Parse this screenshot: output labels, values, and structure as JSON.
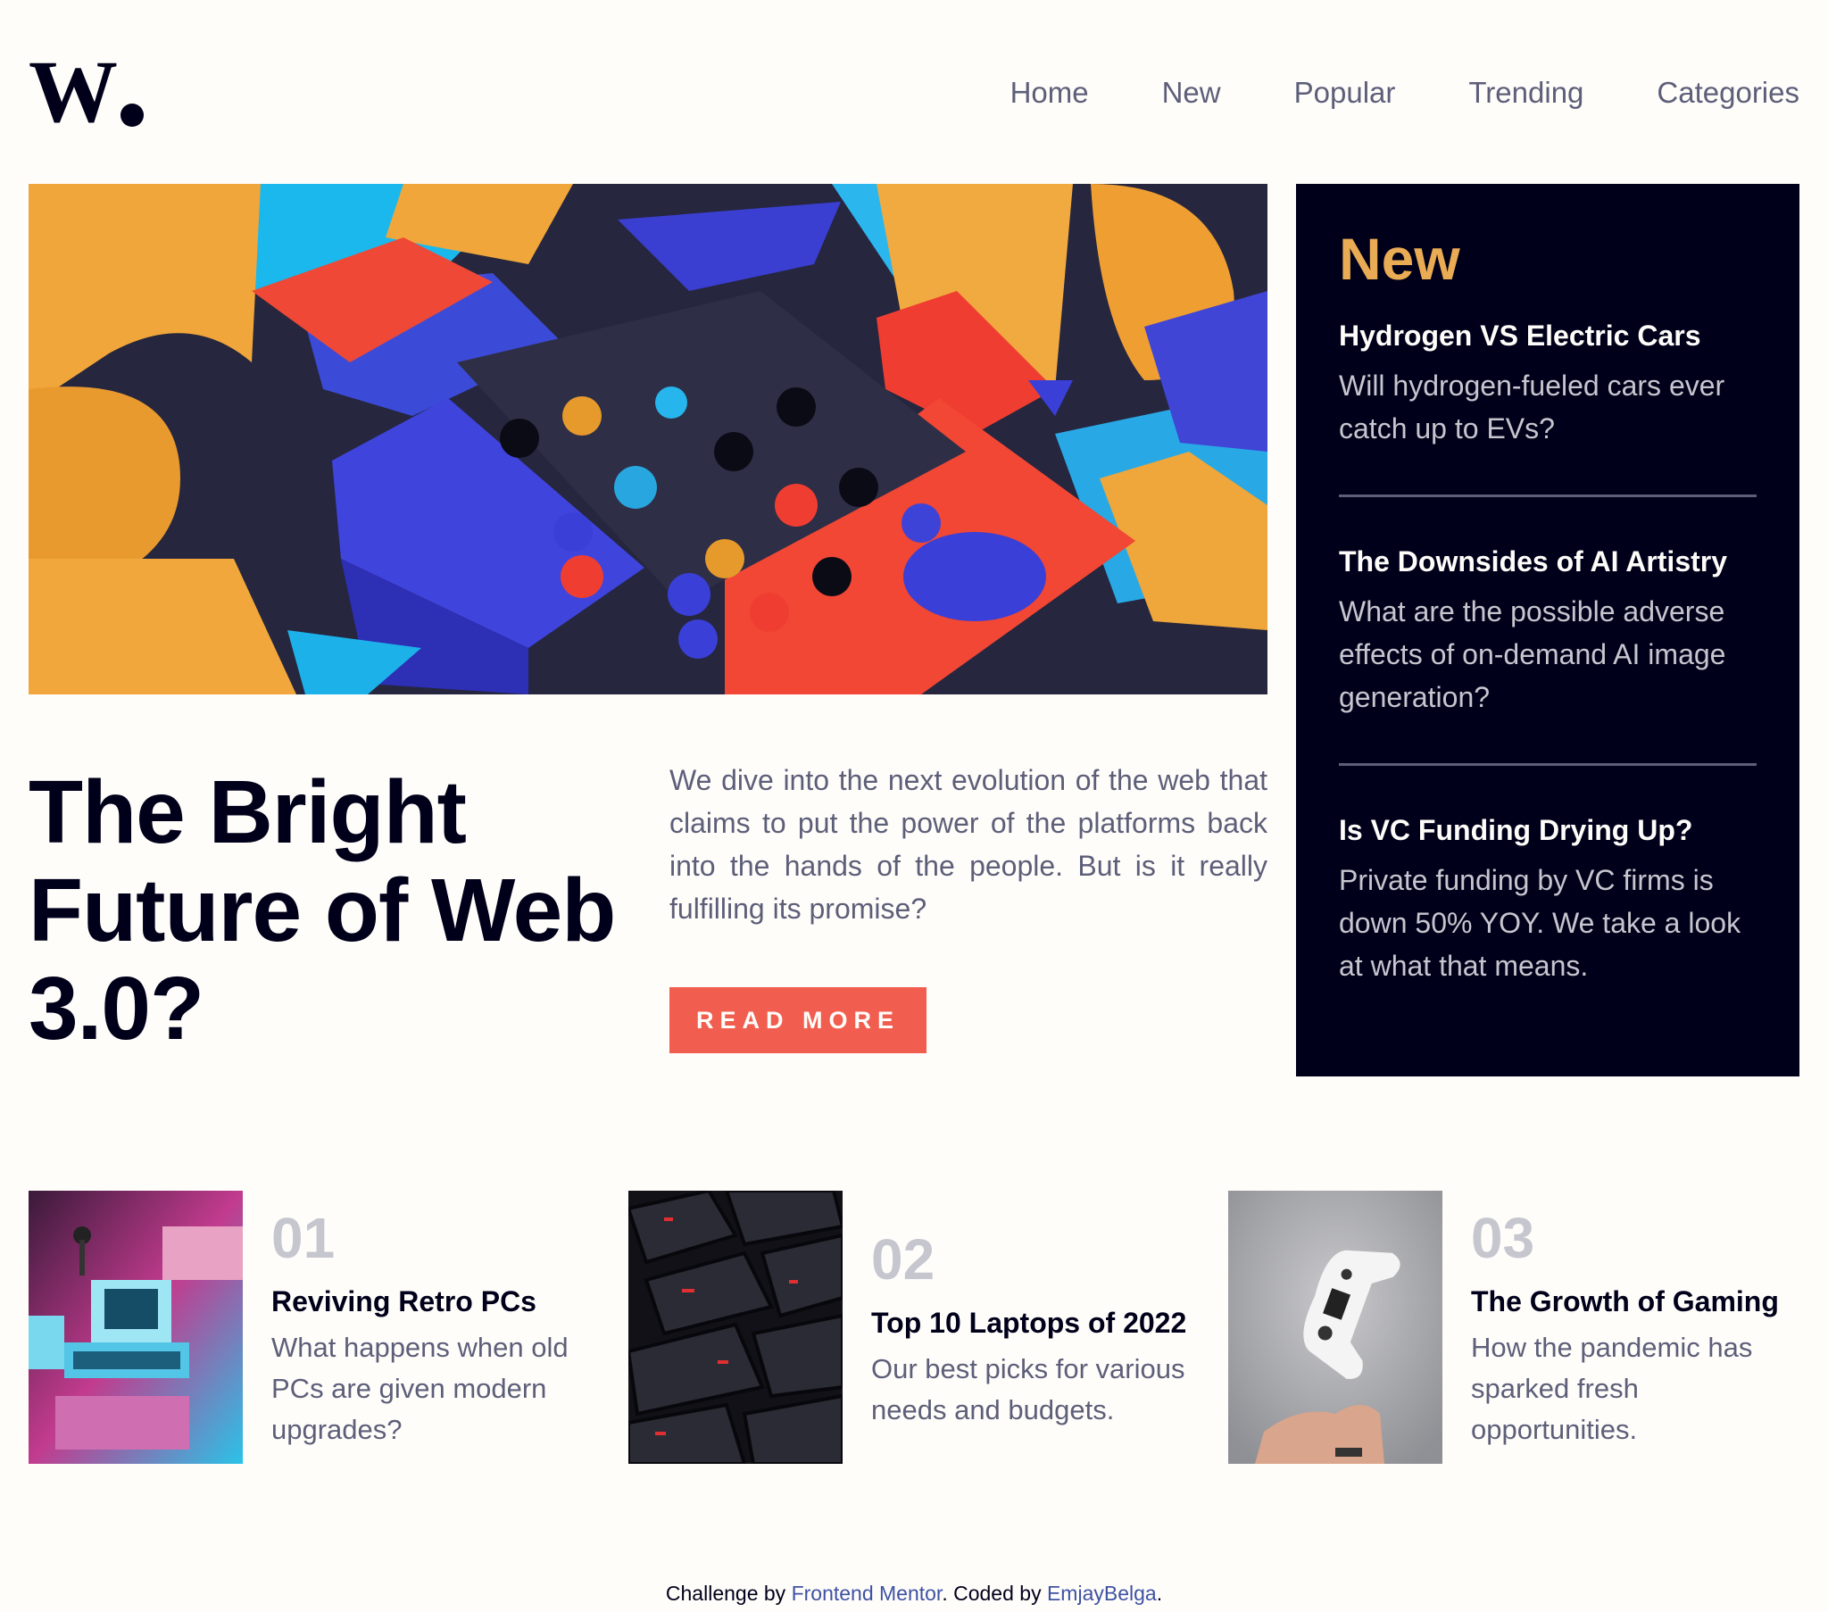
{
  "brand": {
    "logo_text": "W."
  },
  "nav": {
    "items": [
      "Home",
      "New",
      "Popular",
      "Trending",
      "Categories"
    ]
  },
  "hero": {
    "title": "The Bright Future of Web 3.0?",
    "description": "We dive into the next evolution of the web that claims to put the power of the platforms back into the hands of the people. But is it really fulfilling its promise?",
    "button_label": "READ MORE"
  },
  "new_panel": {
    "heading": "New",
    "items": [
      {
        "title": "Hydrogen VS Electric Cars",
        "text": "Will hydrogen-fueled cars ever catch up to EVs?"
      },
      {
        "title": "The Downsides of AI Artistry",
        "text": "What are the possible adverse effects of on-demand AI image generation?"
      },
      {
        "title": "Is VC Funding Drying Up?",
        "text": "Private funding by VC firms is down 50% YOY. We take a look at what that means."
      }
    ]
  },
  "cards": [
    {
      "number": "01",
      "title": "Reviving Retro PCs",
      "text": "What happens when old PCs are given modern upgrades?"
    },
    {
      "number": "02",
      "title": "Top 10 Laptops of 2022",
      "text": "Our best picks for various needs and budgets."
    },
    {
      "number": "03",
      "title": "The Growth of Gaming",
      "text": "How the pandemic has sparked fresh opportunities."
    }
  ],
  "footer": {
    "prefix": "Challenge by ",
    "link1": "Frontend Mentor",
    "middle": ". Coded by ",
    "link2": "EmjayBelga",
    "suffix": "."
  },
  "colors": {
    "accent_red": "#f15e50",
    "accent_orange": "#e9ab53",
    "dark_navy": "#00001a",
    "grayish_blue": "#5d5f79",
    "off_white": "#fffdfa"
  }
}
